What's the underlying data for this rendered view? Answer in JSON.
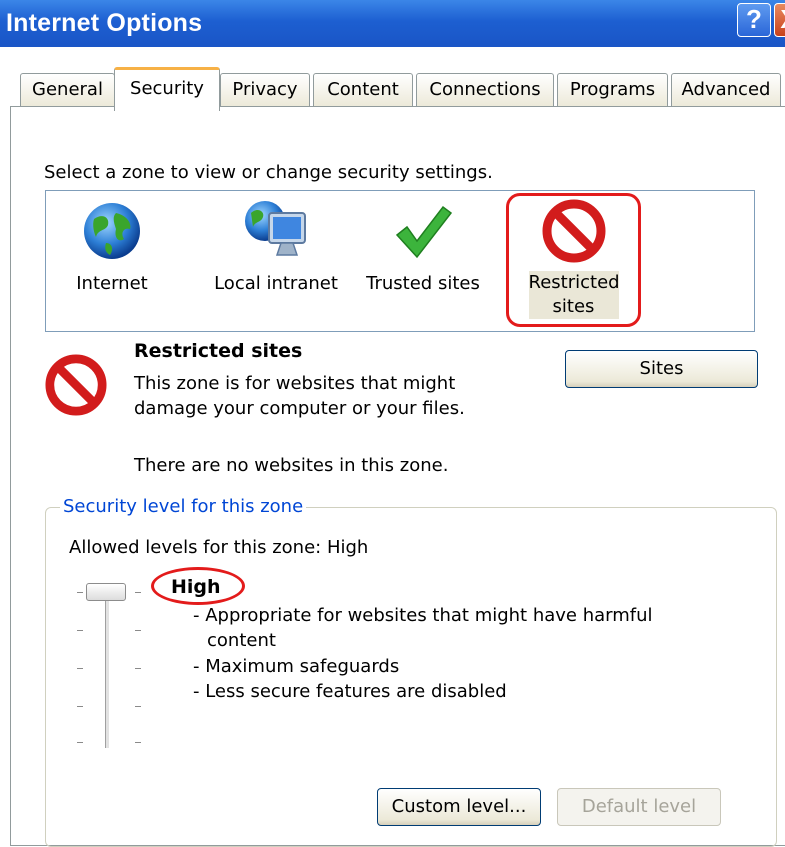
{
  "window": {
    "title": "Internet Options",
    "help_label": "?",
    "close_label": "X"
  },
  "tabs": [
    {
      "label": "General"
    },
    {
      "label": "Security"
    },
    {
      "label": "Privacy"
    },
    {
      "label": "Content"
    },
    {
      "label": "Connections"
    },
    {
      "label": "Programs"
    },
    {
      "label": "Advanced"
    }
  ],
  "zones": {
    "prompt": "Select a zone to view or change security settings.",
    "items": [
      {
        "label": "Internet",
        "icon": "globe-icon"
      },
      {
        "label": "Local intranet",
        "icon": "intranet-icon"
      },
      {
        "label": "Trusted sites",
        "icon": "checkmark-icon"
      },
      {
        "label": "Restricted sites",
        "label_line1": "Restricted",
        "label_line2": "sites",
        "icon": "no-entry-icon"
      }
    ]
  },
  "info": {
    "title": "Restricted sites",
    "line1": "This zone is for websites that might",
    "line2": "damage your computer or your files.",
    "line3": "There are no websites in this zone.",
    "sites_button": "Sites"
  },
  "security_level": {
    "legend": "Security level for this zone",
    "allowed": "Allowed levels for this zone: High",
    "level_name": "High",
    "desc1": "- Appropriate for websites that might have harmful",
    "desc2": "content",
    "desc3": "- Maximum safeguards",
    "desc4": "- Less secure features are disabled",
    "custom_button": "Custom level...",
    "default_button": "Default level"
  },
  "colors": {
    "highlight": "#e31b1b",
    "titlebar": "#1d5fd1",
    "legend": "#0046d5"
  }
}
